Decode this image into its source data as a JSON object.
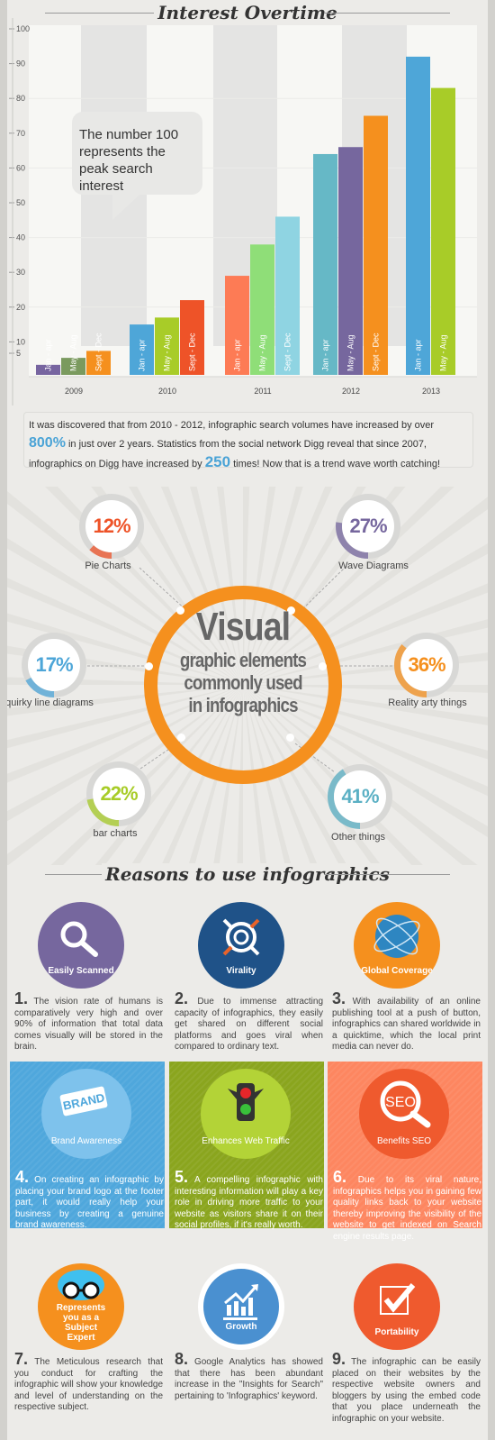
{
  "chart_section": {
    "title": "Interest Overtime",
    "callout": "The number 100 represents the peak search interest"
  },
  "chart_data": {
    "type": "bar",
    "title": "Interest Overtime",
    "xlabel": "",
    "ylabel": "",
    "ylim": [
      0,
      100
    ],
    "yticks": [
      5,
      10,
      20,
      30,
      40,
      50,
      60,
      70,
      80,
      90,
      100
    ],
    "grid": true,
    "groups": [
      {
        "year": "2009",
        "bars": [
          {
            "label": "Jan - apr",
            "value": 6,
            "color": "#7765a0"
          },
          {
            "label": "May - Aug",
            "value": 8,
            "color": "#7a9a5e"
          },
          {
            "label": "Sept - Dec",
            "value": 10,
            "color": "#f5901e"
          }
        ]
      },
      {
        "year": "2010",
        "bars": [
          {
            "label": "Jan - apr",
            "value": 15,
            "color": "#4ea6d8"
          },
          {
            "label": "May - Aug",
            "value": 17,
            "color": "#a8cc28"
          },
          {
            "label": "Sept - Dec",
            "value": 22,
            "color": "#ee5328"
          }
        ]
      },
      {
        "year": "2011",
        "bars": [
          {
            "label": "Jan - apr",
            "value": 29,
            "color": "#fd7b55"
          },
          {
            "label": "May - Aug",
            "value": 38,
            "color": "#8fde78"
          },
          {
            "label": "Sept - Dec",
            "value": 46,
            "color": "#8fd4e2"
          }
        ]
      },
      {
        "year": "2012",
        "bars": [
          {
            "label": "Jan - apr",
            "value": 64,
            "color": "#66b8c6"
          },
          {
            "label": "May - Aug",
            "value": 66,
            "color": "#76679e"
          },
          {
            "label": "Sept - Dec",
            "value": 75,
            "color": "#f5901e"
          }
        ]
      },
      {
        "year": "2013",
        "bars": [
          {
            "label": "Jan - apr",
            "value": 92,
            "color": "#4ea6d8"
          },
          {
            "label": "May - Aug",
            "value": 83,
            "color": "#a8cc28"
          }
        ]
      }
    ]
  },
  "stats": {
    "part1": "It was discovered that from 2010 - 2012, infographic search volumes have increased by over ",
    "big1": "800%",
    "part2": " in just over 2 years. Statistics from the social network Digg reveal that since 2007, infographics on Digg have increased by ",
    "big2": "250",
    "part3": " times! Now that is a trend wave worth catching!"
  },
  "visual": {
    "title_big": "Visual",
    "line1": "graphic elements",
    "line2": "commonly used",
    "line3": "in infographics",
    "ring_color": "#f5901e",
    "items": [
      {
        "percent": "12%",
        "fraction": 0.12,
        "label": "Pie Charts",
        "color": "#ee5328"
      },
      {
        "percent": "27%",
        "fraction": 0.27,
        "label": "Wave Diagrams",
        "color": "#76679e"
      },
      {
        "percent": "17%",
        "fraction": 0.17,
        "label": "quirky line diagrams",
        "color": "#4ea6d8"
      },
      {
        "percent": "36%",
        "fraction": 0.36,
        "label": "Reality arty things",
        "color": "#f5901e"
      },
      {
        "percent": "22%",
        "fraction": 0.22,
        "label": "bar charts",
        "color": "#a8cc28"
      },
      {
        "percent": "41%",
        "fraction": 0.41,
        "label": "Other things",
        "color": "#5bb0c4"
      }
    ]
  },
  "reasons": {
    "title": "Reasons to use infographics",
    "items": [
      {
        "num": "1.",
        "icon": "magnifier-icon",
        "caption": "Easily Scanned",
        "text": "The vision rate of humans is comparatively very high and over 90% of information that total data comes visually will be stored in the brain."
      },
      {
        "num": "2.",
        "icon": "virality-icon",
        "caption": "Virality",
        "text": "Due to immense attracting capacity of infographics, they easily get shared on different social platforms and goes viral when compared to ordinary text."
      },
      {
        "num": "3.",
        "icon": "globe-icon",
        "caption": "Global Coverage",
        "text": "With availability of an online publishing tool at a push of button, infographics can shared worldwide in a quicktime, which the local print media can never do."
      },
      {
        "num": "4.",
        "icon": "brand-tag-icon",
        "caption": "Brand Awareness",
        "badge": "BRAND",
        "text": "On creating an infographic by placing your brand logo at the footer part, it would really help your business by creating a genuine brand awareness."
      },
      {
        "num": "5.",
        "icon": "traffic-light-icon",
        "caption": "Enhances Web Traffic",
        "text": "A compelling infographic with interesting information will play a key role in driving more traffic to your website as visitors share it on their social profiles, if it's really worth."
      },
      {
        "num": "6.",
        "icon": "seo-magnifier-icon",
        "caption": "Benefits SEO",
        "badge": "SEO",
        "text": "Due to its viral nature, infographics helps you in gaining few quality links back to your website thereby improving the visibility of the website to get indexed on Search engine results page."
      },
      {
        "num": "7.",
        "icon": "brain-glasses-icon",
        "caption": "Represents you as a Subject Expert",
        "text": "The Meticulous research that you conduct for crafting the infographic will show your knowledge and level of understanding on the respective subject."
      },
      {
        "num": "8.",
        "icon": "growth-chart-icon",
        "caption": "Growth",
        "text": "Google Analytics has showed that there has been abundant increase in the \"Insights for Search\" pertaining to 'Infographics' keyword."
      },
      {
        "num": "9.",
        "icon": "checkbox-icon",
        "caption": "Portability",
        "text": "The infographic can be easily placed on their websites by the respective website owners and bloggers by using the embed code that you place underneath the infographic on your website."
      }
    ]
  }
}
